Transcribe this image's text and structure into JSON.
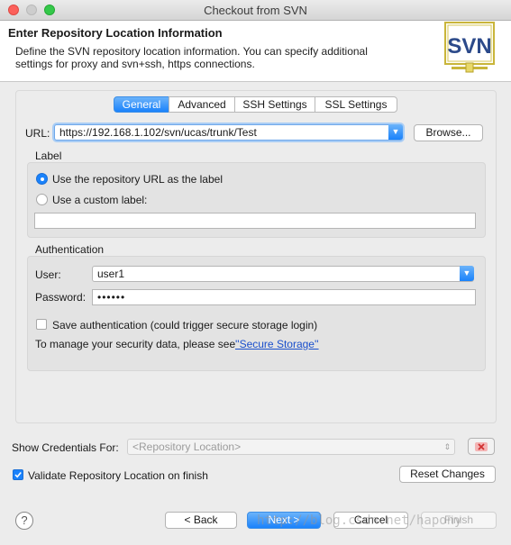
{
  "window": {
    "title": "Checkout from SVN"
  },
  "header": {
    "title": "Enter Repository Location Information",
    "description": "Define the SVN repository location information. You can specify additional settings for proxy and svn+ssh, https connections.",
    "logo_text": "SVN"
  },
  "tabs": [
    {
      "label": "General",
      "active": true
    },
    {
      "label": "Advanced",
      "active": false
    },
    {
      "label": "SSH Settings",
      "active": false
    },
    {
      "label": "SSL Settings",
      "active": false
    }
  ],
  "url": {
    "label": "URL:",
    "value": "https://192.168.1.102/svn/ucas/trunk/Test",
    "browse_label": "Browse..."
  },
  "label_group": {
    "title": "Label",
    "option_repo": "Use the repository URL as the label",
    "option_custom": "Use a custom label:",
    "custom_value": "",
    "selected": "repo"
  },
  "auth": {
    "title": "Authentication",
    "user_label": "User:",
    "user_value": "user1",
    "password_label": "Password:",
    "password_value": "••••••",
    "save_label": "Save authentication (could trigger secure storage login)",
    "save_checked": false,
    "manage_text": "To manage your security data, please see",
    "secure_link": "''Secure Storage''"
  },
  "credentials": {
    "label": "Show Credentials For:",
    "placeholder": "<Repository Location>"
  },
  "validate": {
    "label": "Validate Repository Location on finish",
    "checked": true
  },
  "reset_label": "Reset Changes",
  "footer": {
    "help_icon": "?",
    "back": "< Back",
    "next": "Next >",
    "cancel": "Cancel",
    "finish": "Finish"
  },
  "watermark": "http://blog.csdn.net/hapony",
  "colors": {
    "accent": "#1a82fb",
    "link": "#1a4fcc"
  }
}
